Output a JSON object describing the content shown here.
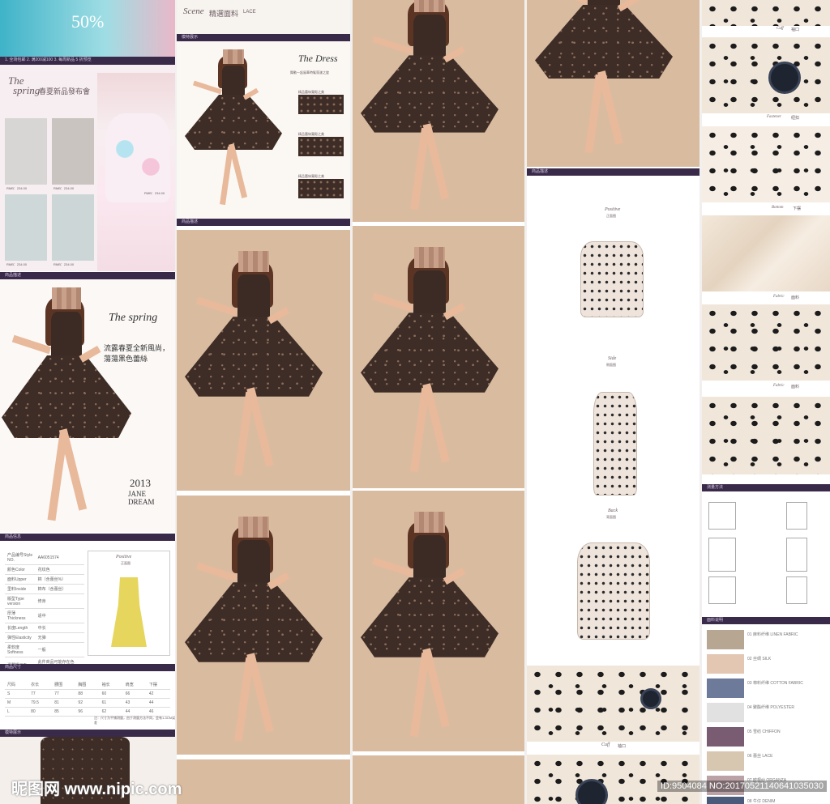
{
  "col1": {
    "sale_text": "50%",
    "promo_bar": "1. 全场包邮    2. 满200减100    3. 每周新品 5 折预览",
    "brand_script": "The",
    "brand_title": "spring",
    "launch_title": "春夏新品發布會",
    "prices": [
      "RMB：234.00",
      "RMB：234.00",
      "RMB：234.00",
      "RMB：234.00"
    ],
    "big_price": "RMB：234.00",
    "section_bar_1": "商品描述",
    "spring_title": "The spring",
    "spring_cn": "流露春夏全新風尚，蕩蕩黑色蕾絲",
    "year": "2013",
    "jane": "JANE",
    "dream": "DREAM",
    "section_bar_2": "商品信息",
    "info_rows": [
      [
        "产品编号Style NO.",
        "AA6051574"
      ],
      [
        "颜色Color",
        "花纹色"
      ],
      [
        "面料Upper",
        "棉（含蕾丝%）"
      ],
      [
        "里料Inside",
        "棉布（含蕾丝）"
      ],
      [
        "版型Type version",
        "修身"
      ],
      [
        "厚薄Thickness",
        "适中"
      ],
      [
        "长度Length",
        "中长"
      ],
      [
        "弹性Elasticity",
        "无弹"
      ],
      [
        "柔软度Softness",
        "一般"
      ],
      [
        "温馨提示Tips",
        "此件商品可能存在色差，请以实物为准"
      ]
    ],
    "side_label": "Positive",
    "side_label_cn": "正面图",
    "section_bar_3": "商品尺寸",
    "size_headers": [
      "尺码",
      "衣长",
      "腰围",
      "胸围",
      "袖长",
      "肩宽",
      "下摆"
    ],
    "size_rows": [
      [
        "S",
        "77",
        "77",
        "88",
        "60",
        "66",
        "42"
      ],
      [
        "M",
        "79.5",
        "81",
        "92",
        "61",
        "43",
        "44"
      ],
      [
        "L",
        "80",
        "85",
        "96",
        "62",
        "44",
        "46"
      ]
    ],
    "size_note": "注：尺寸为平铺测量，由于测量方法不同，会有1-3CM误差",
    "section_bar_4": "模特展示"
  },
  "col2": {
    "heading_script": "Scene",
    "heading_cn": "精選面料",
    "heading_en": "LACE",
    "bar_label": "模特展示",
    "dress_title": "The Dress",
    "dress_sub": "舞動一起風華時髦蕩漾之旋",
    "features": [
      "精品蕾絲寬鬆之美",
      "精品蕾絲寬鬆之美",
      "精品蕾絲寬鬆之美"
    ],
    "bar_label_2": "商品描述"
  },
  "col4": {
    "bar_label": "商品描述",
    "views": [
      {
        "en": "Positive",
        "cn": "正面图"
      },
      {
        "en": "Side",
        "cn": "侧面图"
      },
      {
        "en": "Back",
        "cn": "背面图"
      }
    ],
    "cuff_label": "Cuff",
    "cuff_cn": "袖口"
  },
  "col5": {
    "details": [
      {
        "en": "Cuff",
        "cn": "袖口"
      },
      {
        "en": "Fastener",
        "cn": "纽扣"
      },
      {
        "en": "Bottom",
        "cn": "下摆"
      },
      {
        "en": "Fabric",
        "cn": "面料"
      },
      {
        "en": "Fabric",
        "cn": "面料"
      }
    ],
    "bar_label_1": "测量方法",
    "bar_label_2": "面料说明",
    "fabrics": [
      "01 麻料纤维 LINEN FABRIC",
      "02 丝绸 SILK",
      "03 棉料纤维 COTTON FABRIC",
      "04 聚酯纤维 POLYESTER",
      "05 雪纺 CHIFFON",
      "06 蕾丝 LACE",
      "07 欧根纱 ORGANZA",
      "08 牛仔 DENIM"
    ]
  },
  "watermark": "昵图网 www.nipic.com",
  "id_tag": "ID:9504084 NO:20170521140641035030",
  "colors": {
    "bar": "#3a2a4a",
    "beige": "#dcc2aa",
    "skin": "#e8b99a",
    "dress": "#3d2d26"
  }
}
